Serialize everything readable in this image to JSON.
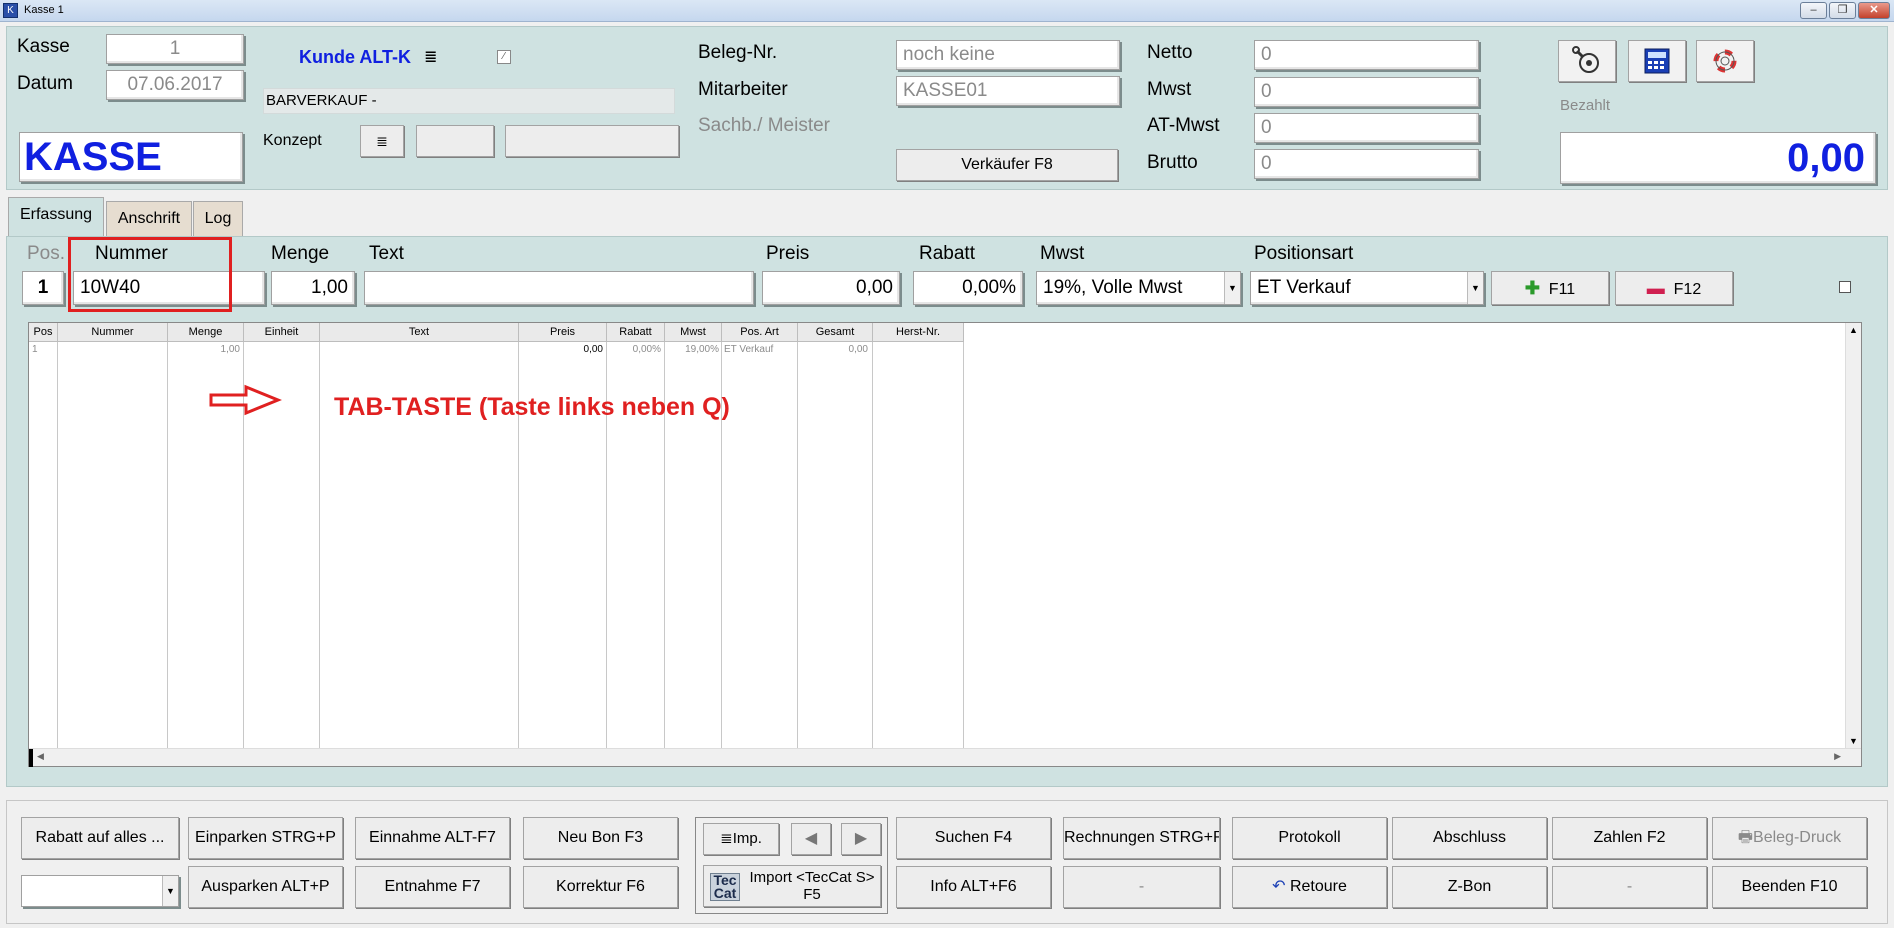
{
  "window": {
    "title": "Kasse 1",
    "controls": [
      "minimize",
      "maximize",
      "close"
    ]
  },
  "header": {
    "kasse_label": "Kasse",
    "kasse_value": "1",
    "datum_label": "Datum",
    "datum_value": "07.06.2017",
    "mode_title": "KASSE",
    "kunde_label": "Kunde ALT-K",
    "kunde_menu_icon": "≣",
    "kunde_name": "BARVERKAUF -",
    "konzept_label": "Konzept",
    "konzept_icon": "≣",
    "beleg_label": "Beleg-Nr.",
    "beleg_value": "noch keine",
    "mitarbeiter_label": "Mitarbeiter",
    "mitarbeiter_value": "KASSE01",
    "sachb_label": "Sachb./ Meister",
    "verkaeufer_button": "Verkäufer F8",
    "netto_label": "Netto",
    "netto_value": "0",
    "mwst_label": "Mwst",
    "mwst_value": "0",
    "atmwst_label": "AT-Mwst",
    "atmwst_value": "0",
    "brutto_label": "Brutto",
    "brutto_value": "0",
    "bezahlt_label": "Bezahlt",
    "bezahlt_value": "0,00",
    "tool_icons": [
      "tool-wrench-icon",
      "register-icon",
      "lifebuoy-icon"
    ]
  },
  "tabs": [
    "Erfassung",
    "Anschrift",
    "Log"
  ],
  "entry": {
    "headers": {
      "pos": "Pos.",
      "nummer": "Nummer",
      "menge": "Menge",
      "text": "Text",
      "preis": "Preis",
      "rabatt": "Rabatt",
      "mwst": "Mwst",
      "positionsart": "Positionsart"
    },
    "values": {
      "pos": "1",
      "nummer": "10W40",
      "menge": "1,00",
      "text": "",
      "preis": "0,00",
      "rabatt": "0,00%",
      "mwst": "19%, Volle Mwst",
      "positionsart": "ET Verkauf"
    },
    "add_button": "F11",
    "remove_button": "F12",
    "highlight_color": "#e02020"
  },
  "grid": {
    "columns": [
      "Pos",
      "Nummer",
      "Menge",
      "Einheit",
      "Text",
      "Preis",
      "Rabatt",
      "Mwst",
      "Pos. Art",
      "Gesamt",
      "Herst-Nr."
    ],
    "rows": [
      {
        "pos": "1",
        "nummer": "",
        "menge": "1,00",
        "einheit": "",
        "text": "",
        "preis": "0,00",
        "rabatt": "0,00%",
        "mwst": "19,00%",
        "posart": "ET Verkauf",
        "gesamt": "0,00",
        "herst": ""
      }
    ]
  },
  "annotation": {
    "text": "TAB-TASTE (Taste links neben Q)",
    "color": "#e02020"
  },
  "buttons": {
    "rabatt": "Rabatt auf alles ...",
    "einparken": "Einparken STRG+P",
    "ausparken": "Ausparken ALT+P",
    "einnahme": "Einnahme ALT-F7",
    "entnahme": "Entnahme F7",
    "neubon": "Neu Bon F3",
    "korrektur": "Korrektur F6",
    "imp": "Imp.",
    "tecdoc_logo": "Tec Cat",
    "import": "Import <TecCat S> F5",
    "suchen": "Suchen F4",
    "info": "Info ALT+F6",
    "rechnungen": "Rechnungen STRG+R",
    "dash1": "-",
    "protokoll": "Protokoll",
    "retoure": "Retoure",
    "abschluss": "Abschluss",
    "zbon": "Z-Bon",
    "zahlen": "Zahlen F2",
    "dash2": "-",
    "belegdruck": "Beleg-Druck",
    "beenden": "Beenden F10"
  },
  "colors": {
    "panel": "#cfe2e1",
    "kunde": "#1020e0",
    "total": "#1020e0",
    "title": "#1020e0"
  }
}
